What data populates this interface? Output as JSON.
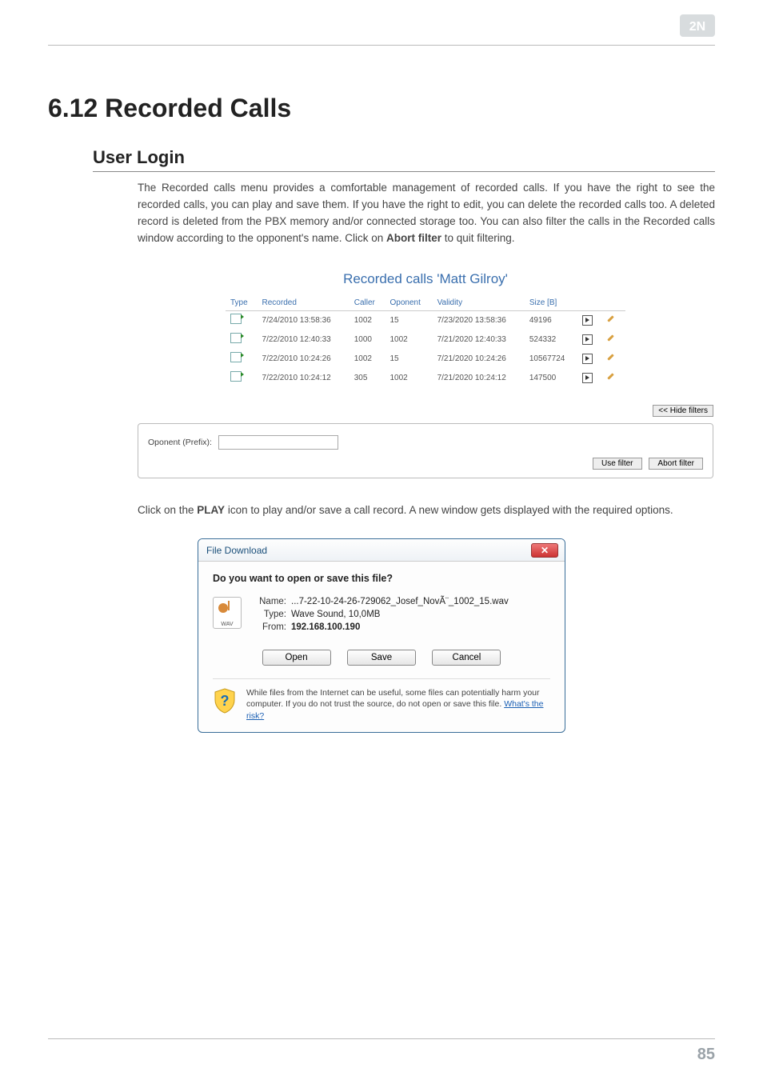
{
  "header": {
    "logo_text": "2N"
  },
  "title": "6.12 Recorded Calls",
  "section_title": "User Login",
  "intro_paragraph": "The Recorded calls menu provides a comfortable management of recorded calls. If you have the right to see the recorded calls, you can play and save them. If you have the right to edit, you can delete the recorded calls too. A deleted record is deleted from the PBX memory and/or connected storage too. You can also filter the calls in the Recorded calls window according to the opponent's name. Click on ",
  "intro_bold": "Abort filter",
  "intro_tail": " to quit filtering.",
  "panel": {
    "title": "Recorded calls 'Matt Gilroy'",
    "headers": {
      "type": "Type",
      "recorded": "Recorded",
      "caller": "Caller",
      "oponent": "Oponent",
      "validity": "Validity",
      "size": "Size [B]"
    },
    "rows": [
      {
        "recorded": "7/24/2010 13:58:36",
        "caller": "1002",
        "oponent": "15",
        "validity": "7/23/2020 13:58:36",
        "size": "49196"
      },
      {
        "recorded": "7/22/2010 12:40:33",
        "caller": "1000",
        "oponent": "1002",
        "validity": "7/21/2020 12:40:33",
        "size": "524332"
      },
      {
        "recorded": "7/22/2010 10:24:26",
        "caller": "1002",
        "oponent": "15",
        "validity": "7/21/2020 10:24:26",
        "size": "10567724"
      },
      {
        "recorded": "7/22/2010 10:24:12",
        "caller": "305",
        "oponent": "1002",
        "validity": "7/21/2020 10:24:12",
        "size": "147500"
      }
    ],
    "hide_filters": "<<  Hide filters",
    "filter_label": "Oponent (Prefix):",
    "use_filter": "Use filter",
    "abort_filter": "Abort filter"
  },
  "mid_paragraph_pre": "Click on the ",
  "mid_paragraph_bold": "PLAY",
  "mid_paragraph_post": " icon to play and/or save a call record. A new window gets displayed with the required options.",
  "dlg": {
    "title": "File Download",
    "question": "Do you want to open or save this file?",
    "wav_label": "WAV",
    "name_label": "Name:",
    "name_value": "...7-22-10-24-26-729062_Josef_NovÃ¨_1002_15.wav",
    "type_label": "Type:",
    "type_value": "Wave Sound, 10,0MB",
    "from_label": "From:",
    "from_value": "192.168.100.190",
    "open": "Open",
    "save": "Save",
    "cancel": "Cancel",
    "warning_text": "While files from the Internet can be useful, some files can potentially harm your computer. If you do not trust the source, do not open or save this file. ",
    "warning_link": "What's the risk?"
  },
  "page_number": "85"
}
